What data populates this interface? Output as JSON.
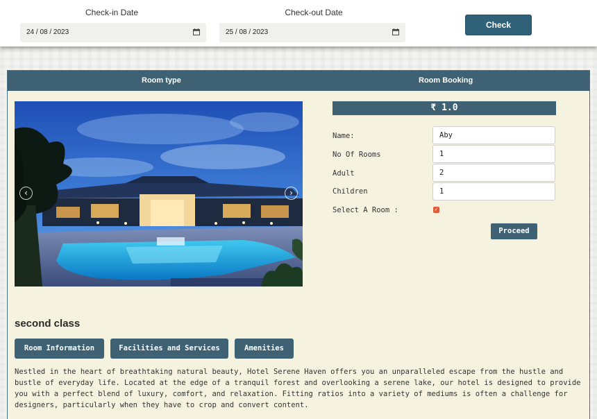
{
  "search": {
    "checkin_label": "Check-in Date",
    "checkin_value": "24 / 08 / 2023",
    "checkout_label": "Check-out Date",
    "checkout_value": "25 / 08 / 2023",
    "check_button": "Check"
  },
  "panel": {
    "header_left": "Room type",
    "header_right": "Room Booking"
  },
  "booking": {
    "price": "₹ 1.0",
    "fields": [
      {
        "label": "Name:",
        "value": "Aby"
      },
      {
        "label": "No Of Rooms",
        "value": "1"
      },
      {
        "label": "Adult",
        "value": "2"
      },
      {
        "label": "Children",
        "value": "1"
      }
    ],
    "select_room_label": "Select A Room :",
    "select_room_checked": true,
    "proceed_button": "Proceed"
  },
  "carousel": {
    "prev_icon": "chevron-left-icon",
    "next_icon": "chevron-right-icon",
    "prev_glyph": "‹",
    "next_glyph": "›"
  },
  "room": {
    "title": "second class",
    "tabs": [
      "Room Information",
      "Facilities and Services",
      "Amenities"
    ],
    "description": "Nestled in the heart of breathtaking natural beauty, Hotel Serene Haven offers you an unparalleled escape from the hustle and bustle of everyday life. Located at the edge of a tranquil forest and overlooking a serene lake, our hotel is designed to provide you with a perfect blend of luxury, comfort, and relaxation. Fitting ratios into a variety of mediums is often a challenge for designers, particularly when they have to crop and convert content."
  },
  "colors": {
    "accent": "#3e6273",
    "button_dark": "#2f6179",
    "panel_bg": "#f5f3df",
    "checkbox": "#e05a3a"
  }
}
